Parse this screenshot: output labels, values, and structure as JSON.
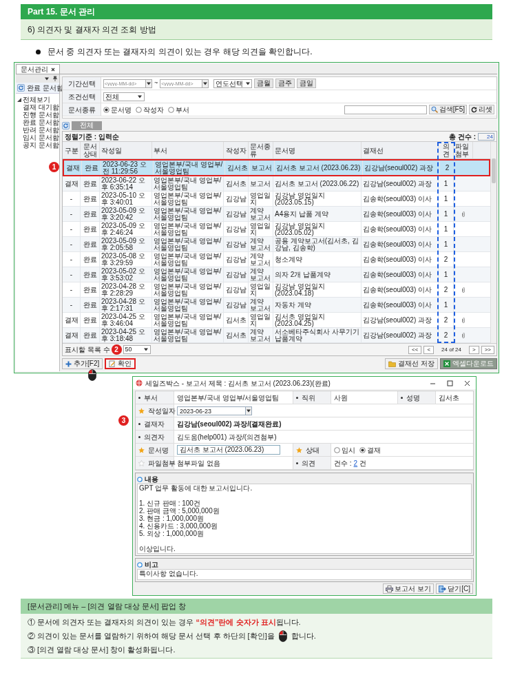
{
  "doc_header": {
    "part_title": "Part 15. 문서 관리",
    "section_title": "6) 의견자 및 결재자 의견 조회 방법"
  },
  "intro": "문서 중 의견자 또는 결재자의 의견이 있는 경우 해당 의견을 확인합니다.",
  "app": {
    "tabs": [
      {
        "label": "문서관리",
        "selected": true
      }
    ],
    "sidebar": {
      "folder_title": "완료 문서함",
      "tree": [
        {
          "label": "전체보기",
          "expanded": true,
          "children": [
            {
              "label": "결재 대기함"
            },
            {
              "label": "진행 문서함"
            },
            {
              "label": "완료 문서함"
            },
            {
              "label": "반려 문서함"
            },
            {
              "label": "임시 문서함"
            },
            {
              "label": "공지 문서함"
            }
          ]
        }
      ]
    },
    "filters": {
      "period_label": "기간선택",
      "date_from": {
        "placeholder": "<yyyy-MM-dd>"
      },
      "range_sep": "~",
      "date_to": {
        "placeholder": "<yyyy-MM-dd>"
      },
      "year_select": "연도선택",
      "period_buttons": [
        "금월",
        "금주",
        "금일"
      ],
      "condition_label": "조건선택",
      "condition_value": "전체",
      "doc_type_label": "문서종류",
      "doc_type_options": [
        {
          "label": "문서명",
          "selected": true
        },
        {
          "label": "작성자",
          "selected": false
        },
        {
          "label": "부서",
          "selected": false
        }
      ],
      "search_button": "검색[F5]",
      "reset_button": "리셋"
    },
    "filter_tabs": [
      {
        "label": "전체",
        "selected": true
      }
    ],
    "sort_label": "정렬기준 : 입력순",
    "total_label": "총 건수 :",
    "total_value": "24",
    "table": {
      "columns": [
        "구분",
        "문서상태",
        "작성일",
        "부서",
        "작성자",
        "문서종류",
        "문서명",
        "결재선",
        "의견",
        "파일첨부"
      ],
      "rows": [
        {
          "cells": [
            "결재",
            "완료",
            "2023-06-23 오전 11:29:56",
            "영업본부/국내 영업부/서울영업팀",
            "김서초",
            "보고서",
            "김서초 보고서 (2023.06.23)",
            "김강남(seoul002) 과장"
          ],
          "opinions": "2",
          "attached": false,
          "selected": true
        },
        {
          "cells": [
            "결재",
            "완료",
            "2023-06-22 오후 6:35:14",
            "영업본부/국내 영업부/서울영업팀",
            "김서초",
            "보고서",
            "김서초 보고서 (2023.06.22)",
            "김강남(seoul002) 과장"
          ],
          "opinions": "1",
          "attached": false,
          "selected": false
        },
        {
          "cells": [
            "-",
            "완료",
            "2023-05-10 오후 3:40:01",
            "영업본부/국내 영업부/서울영업팀",
            "김강남",
            "영업일지",
            "김강남 영업일지 (2023.05.15)",
            "김송학(seoul003) 이사"
          ],
          "opinions": "1",
          "attached": false,
          "selected": false
        },
        {
          "cells": [
            "-",
            "완료",
            "2023-05-09 오후 3:20:42",
            "영업본부/국내 영업부/서울영업팀",
            "김강남",
            "계약 보고서",
            "A4용지 납품 계약",
            "김송학(seoul003) 이사"
          ],
          "opinions": "1",
          "attached": true,
          "selected": false
        },
        {
          "cells": [
            "-",
            "완료",
            "2023-05-09 오후 2:46:24",
            "영업본부/국내 영업부/서울영업팀",
            "김강남",
            "영업일지",
            "김강남 영업일지 (2023.05.02)",
            "김송학(seoul003) 이사"
          ],
          "opinions": "1",
          "attached": false,
          "selected": false
        },
        {
          "cells": [
            "-",
            "완료",
            "2023-05-09 오후 2:05:58",
            "영업본부/국내 영업부/서울영업팀",
            "김강남",
            "계약 보고서",
            "공용 계약보고서(김서초, 김강남, 김송학)",
            "김송학(seoul003) 이사"
          ],
          "opinions": "1",
          "attached": false,
          "selected": false
        },
        {
          "cells": [
            "-",
            "완료",
            "2023-05-08 오후 3:29:59",
            "영업본부/국내 영업부/서울영업팀",
            "김강남",
            "계약 보고서",
            "청소계약",
            "김송학(seoul003) 이사"
          ],
          "opinions": "2",
          "attached": false,
          "selected": false
        },
        {
          "cells": [
            "-",
            "완료",
            "2023-05-02 오후 3:53:02",
            "영업본부/국내 영업부/서울영업팀",
            "김강남",
            "계약 보고서",
            "의자 2개 납품계약",
            "김송학(seoul003) 이사"
          ],
          "opinions": "1",
          "attached": false,
          "selected": false
        },
        {
          "cells": [
            "-",
            "완료",
            "2023-04-28 오후 2:28:29",
            "영업본부/국내 영업부/서울영업팀",
            "김강남",
            "영업일지",
            "김강남 영업일지 (2023.04.18)",
            "김송학(seoul003) 이사"
          ],
          "opinions": "2",
          "attached": true,
          "selected": false
        },
        {
          "cells": [
            "-",
            "완료",
            "2023-04-28 오후 2:17:31",
            "영업본부/국내 영업부/서울영업팀",
            "김강남",
            "계약 보고서",
            "자동차 계약",
            "김송학(seoul003) 이사"
          ],
          "opinions": "1",
          "attached": false,
          "selected": false
        },
        {
          "cells": [
            "결재",
            "완료",
            "2023-04-25 오후 3:46:04",
            "영업본부/국내 영업부/서울영업팀",
            "김서초",
            "영업일지",
            "김서초 영업일지 (2023.04.25)",
            "김강남(seoul002) 과장"
          ],
          "opinions": "2",
          "attached": true,
          "selected": false
        },
        {
          "cells": [
            "결재",
            "완료",
            "2023-04-25 오후 3:18:48",
            "영업본부/국내 영업부/서울영업팀",
            "김서초",
            "계약 보고서",
            "서소베타주식회사 사무기기 납품계약",
            "김강남(seoul002) 과장"
          ],
          "opinions": "2",
          "attached": true,
          "selected": false
        }
      ]
    },
    "page_size_label": "표시할 목록 수",
    "page_size": "50",
    "pager": {
      "first": "<<",
      "prev": "<",
      "info": "24 of 24",
      "next": ">",
      "last": ">>"
    },
    "buttons_left": [
      {
        "label": "추가[F2]",
        "kind": "add",
        "highlighted": false
      },
      {
        "label": "확인",
        "kind": "confirm",
        "highlighted": true
      }
    ],
    "buttons_right": [
      {
        "label": "결재선 저장",
        "kind": "folder"
      },
      {
        "label": "엑셀다운로드",
        "kind": "excel"
      }
    ]
  },
  "markers": [
    "1",
    "2",
    "3"
  ],
  "popup": {
    "title": "세일즈박스 - 보고서 제목 : 김서초 보고서 (2023.06.23)(완료)",
    "form_rows": [
      [
        {
          "label": "부서",
          "starred": false,
          "kind": "text",
          "value": "영업본부/국내 영업부/서울영업팀",
          "bold": false
        },
        {
          "label": "직위",
          "starred": false,
          "kind": "text",
          "value": "사원",
          "bold": false
        },
        {
          "label": "성명",
          "starred": false,
          "kind": "text",
          "value": "김서초",
          "bold": false
        }
      ],
      [
        {
          "label": "작성일자",
          "starred": true,
          "filled": true,
          "kind": "date",
          "value": "2023-06-23"
        }
      ],
      [
        {
          "label": "결재자",
          "starred": false,
          "kind": "text",
          "value": "김강남(seoul002) 과장/(결재완료)",
          "bold": true
        }
      ],
      [
        {
          "label": "의견자",
          "starred": false,
          "kind": "text",
          "value": "김도움(help001) 과장/(의견첨부)",
          "bold": false
        }
      ],
      [
        {
          "label": "문서명",
          "starred": true,
          "filled": true,
          "kind": "input",
          "value": "김서초 보고서 (2023.06.23)"
        },
        {
          "label": "상태",
          "starred": true,
          "filled": true,
          "kind": "radio",
          "options": [
            {
              "label": "임시",
              "selected": false
            },
            {
              "label": "결재",
              "selected": true
            }
          ]
        }
      ],
      [
        {
          "label": "파일첨부",
          "starred": true,
          "filled": false,
          "kind": "text",
          "value": "첨부파일 없음",
          "bold": false
        },
        {
          "label": "의견",
          "starred": false,
          "kind": "count",
          "prefix": "건수 :",
          "count": "2",
          "suffix": "건"
        }
      ]
    ],
    "content_title": "내용",
    "content": "GPT 업무 활동에 대한 보고서입니다.\n\n1. 신규 판매 : 100건\n2. 판매 금액 : 5,000,000원\n3. 현금 : 1,000,000원\n4. 신용카드 : 3,000,000원\n5. 외상 : 1,000,000원\n\n이상입니다.",
    "remarks_title": "비고",
    "remarks": "특이사항 없습니다.",
    "buttons": [
      {
        "label": "보고서 보기",
        "kind": "print"
      },
      {
        "label": "닫기[C]",
        "kind": "close"
      }
    ]
  },
  "notes_title": "[문서관리] 메뉴 – [의견 열람 대상 문서] 팝업 창",
  "notes": [
    {
      "segments": [
        {
          "kind": "text",
          "text": "① 문서에 의견자 또는 결재자의 의견이 있는 경우 "
        },
        {
          "kind": "emphasis",
          "text": "“의견”란에 숫자가 표시"
        },
        {
          "kind": "text",
          "text": "됩니다."
        }
      ]
    },
    {
      "segments": [
        {
          "kind": "text",
          "text": "② 의견이 있는 문서를 열람하기 위하여 해당 문서 선택 후 하단의 [확인]을"
        },
        {
          "kind": "mouse"
        },
        {
          "kind": "text",
          "text": "합니다."
        }
      ]
    },
    {
      "segments": [
        {
          "kind": "text",
          "text": "③ [의견 열람 대상 문서] 창이 활성화됩니다."
        }
      ]
    }
  ]
}
